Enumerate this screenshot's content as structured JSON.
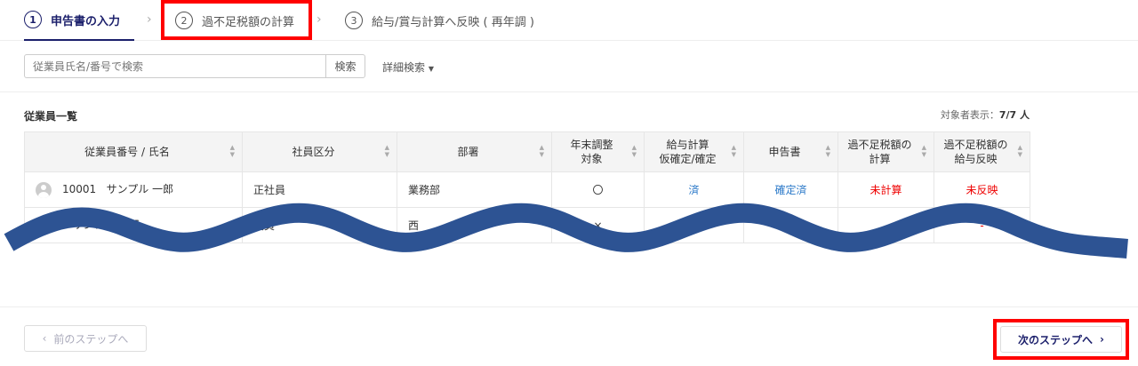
{
  "steps": [
    {
      "num": "1",
      "label": "申告書の入力"
    },
    {
      "num": "2",
      "label": "過不足税額の計算"
    },
    {
      "num": "3",
      "label": "給与/賞与計算へ反映 ( 再年調 )"
    }
  ],
  "search": {
    "placeholder": "従業員氏名/番号で検索",
    "button": "検索",
    "advanced": "詳細検索"
  },
  "list": {
    "title": "従業員一覧",
    "count_label": "対象者表示：",
    "count_value": "7/7 人"
  },
  "table": {
    "headers": [
      [
        "従業員番号 / 氏名"
      ],
      [
        "社員区分"
      ],
      [
        "部署"
      ],
      [
        "年末調整",
        "対象"
      ],
      [
        "給与計算",
        "仮確定/確定"
      ],
      [
        "申告書"
      ],
      [
        "過不足税額の",
        "計算"
      ],
      [
        "過不足税額の",
        "給与反映"
      ]
    ],
    "rows": [
      {
        "id": "10001",
        "name": "サンプル 一郎",
        "type": "正社員",
        "dept": "業務部",
        "target": "〇",
        "payroll": "済",
        "form": "確定済",
        "calc": "未計算",
        "reflect": "未反映"
      },
      {
        "id": "",
        "name": "サンプル 二郎",
        "type": "役員",
        "dept": "西　　　　部",
        "target": "×",
        "payroll": "",
        "form": "",
        "calc": "-",
        "reflect": "-"
      }
    ]
  },
  "footer": {
    "prev": "前のステップへ",
    "next": "次のステップへ"
  },
  "colors": {
    "accent": "#1b1f6b",
    "link": "#2a78c8",
    "alert": "#e00000",
    "wave": "#2d5393"
  }
}
